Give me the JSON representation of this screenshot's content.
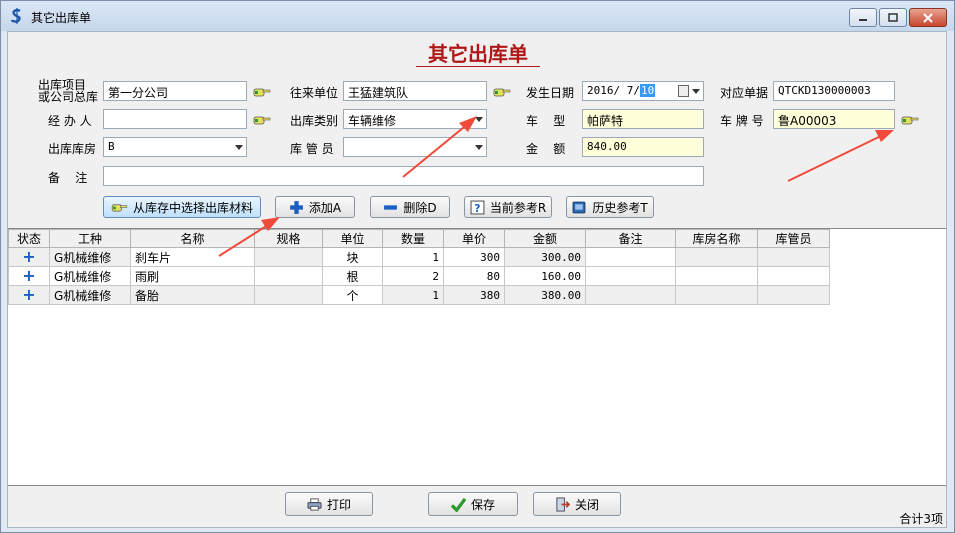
{
  "window": {
    "title": "其它出库单",
    "app_icon": "dollar-s-icon",
    "controls": [
      "minimize-icon",
      "maximize-icon",
      "close-icon"
    ]
  },
  "form": {
    "title": "其它出库单",
    "fields": {
      "project_label": "出库项目\n或公司总库",
      "project_value": "第一分公司",
      "partner_label": "往来单位",
      "partner_value": "王猛建筑队",
      "date_label": "发生日期",
      "date_prefix": "2016/ 7/",
      "date_day": "10",
      "ref_no_label": "对应单据",
      "ref_no_value": "QTCKD130000003",
      "handler_label": "经 办 人",
      "handler_value": "",
      "out_type_label": "出库类别",
      "out_type_value": "车辆维修",
      "car_model_label": "车    型",
      "car_model_value": "帕萨特",
      "plate_label": "车 牌 号",
      "plate_value": "鲁A00003",
      "warehouse_label": "出库库房",
      "warehouse_value": "B",
      "keeper_label": "库 管 员",
      "keeper_value": "",
      "amount_label": "金    额",
      "amount_value": "840.00",
      "remark_label": "备    注",
      "remark_value": ""
    },
    "buttons": {
      "select_from_stock": "从库存中选择出库材料",
      "add": "添加A",
      "delete": "删除D",
      "current_ref": "当前参考R",
      "history_ref": "历史参考T"
    }
  },
  "grid": {
    "columns": [
      "状态",
      "工种",
      "名称",
      "规格",
      "单位",
      "数量",
      "单价",
      "金额",
      "备注",
      "库房名称",
      "库管员"
    ],
    "rows": [
      {
        "status": "+",
        "trade": "G机械维修",
        "name": "刹车片",
        "spec": "",
        "unit": "块",
        "qty": "1",
        "price": "300",
        "amount": "300.00",
        "remark": "",
        "warehouse": "",
        "keeper": ""
      },
      {
        "status": "+",
        "trade": "G机械维修",
        "name": "雨刷",
        "spec": "",
        "unit": "根",
        "qty": "2",
        "price": "80",
        "amount": "160.00",
        "remark": "",
        "warehouse": "",
        "keeper": ""
      },
      {
        "status": "+",
        "trade": "G机械维修",
        "name": "备胎",
        "spec": "",
        "unit": "个",
        "qty": "1",
        "price": "380",
        "amount": "380.00",
        "remark": "",
        "warehouse": "",
        "keeper": ""
      }
    ]
  },
  "footer": {
    "print": "打印",
    "save": "保存",
    "close": "关闭",
    "total": "合计3项"
  },
  "colors": {
    "title_red": "#b01818",
    "annotation_arrow": "#f04a3a",
    "readonly_field": "#ffffd9"
  }
}
